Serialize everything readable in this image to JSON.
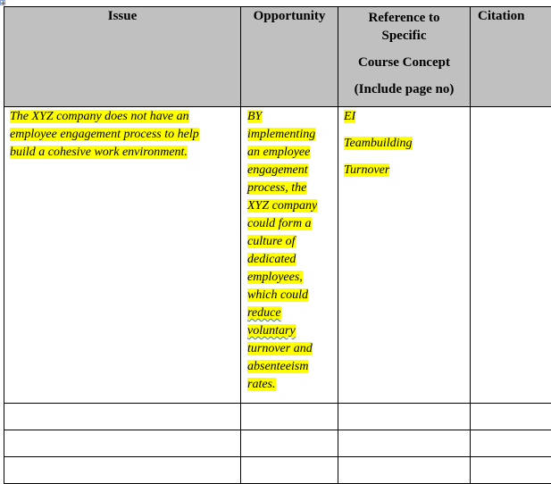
{
  "document": {
    "table": {
      "headers": {
        "issue": "Issue",
        "opportunity": "Opportunity",
        "reference_lines": [
          "Reference to",
          "Specific",
          "Course Concept",
          "(Include page no)"
        ],
        "citation": "Citation"
      },
      "rows": [
        {
          "issue_lines": [
            "The XYZ company does not have an",
            "employee engagement process to help",
            "build a cohesive work environment."
          ],
          "opportunity_lines": [
            "BY",
            "implementing",
            "an employee",
            "engagement",
            "process, the",
            "XYZ company",
            "could form a",
            "culture of",
            "dedicated",
            "employees,",
            "which could",
            "reduce",
            "voluntary",
            "turnover and",
            "absenteeism",
            "rates."
          ],
          "reference_items": [
            "EI",
            "Teambuilding",
            "Turnover"
          ],
          "citation": ""
        },
        {
          "issue": "",
          "opportunity": "",
          "reference": "",
          "citation": ""
        },
        {
          "issue": "",
          "opportunity": "",
          "reference": "",
          "citation": ""
        },
        {
          "issue": "",
          "opportunity": "",
          "reference": "",
          "citation": ""
        }
      ]
    },
    "colors": {
      "header_bg": "#c0c0c0",
      "highlight": "#ffff00",
      "spellcheck_underline": "#2e8b57"
    }
  }
}
